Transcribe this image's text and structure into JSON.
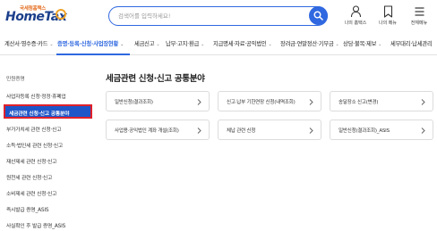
{
  "header": {
    "logo_small": "국세청홈택스",
    "logo_big": "HomeTax",
    "badge_text": "",
    "search_placeholder": "검색어를 입력하세요!",
    "icons": [
      {
        "label": "나의 홈택스",
        "icon": "person-icon"
      },
      {
        "label": "나의 메뉴",
        "icon": "bookmark-icon"
      },
      {
        "label": "전체메뉴",
        "icon": "menu-icon"
      }
    ]
  },
  "nav": {
    "items": [
      {
        "label": "계산서·영수증·카드",
        "active": false
      },
      {
        "label": "증명·등록·신청·사업장현황",
        "active": true
      },
      {
        "label": "세금신고",
        "active": false
      },
      {
        "label": "납부·고지·환급",
        "active": false
      },
      {
        "label": "지급명세·자료·공익법인",
        "active": false
      },
      {
        "label": "장려금·연말정산·기부금",
        "active": false
      },
      {
        "label": "상담·불복·제보",
        "active": false
      },
      {
        "label": "세무대리·납세관리",
        "active": false
      }
    ]
  },
  "sidebar": {
    "items": [
      "민원증명",
      "사업자등록 신청·정정·휴폐업",
      "세금관련 신청·신고 공통분야",
      "부가가치세 관련 신청·신고",
      "소득·법인세 관련 신청·신고",
      "재산제세 관련 신청·신고",
      "원천세 관련 신청·신고",
      "소비제세 관련 신청·신고",
      "즉시발급 증명_ASIS",
      "사실확인 후 발급 증명_ASIS"
    ],
    "active_label": "세금관련 신청·신고 공통분야"
  },
  "main": {
    "title": "세금관련 신청·신고 공통분야",
    "cards": [
      "일반신청(결과조회)",
      "신고·납부 기한연장 신청(내역조회)",
      "송달장소 신고(변경)",
      "사업용·공익법인 계좌 개설(조회)",
      "체납 관련 신청",
      "일반신청(결과조회)_ASIS"
    ]
  },
  "colors": {
    "accent": "#2f68e0",
    "active_bg": "#1e55c8",
    "highlight_border": "#e0202a"
  }
}
